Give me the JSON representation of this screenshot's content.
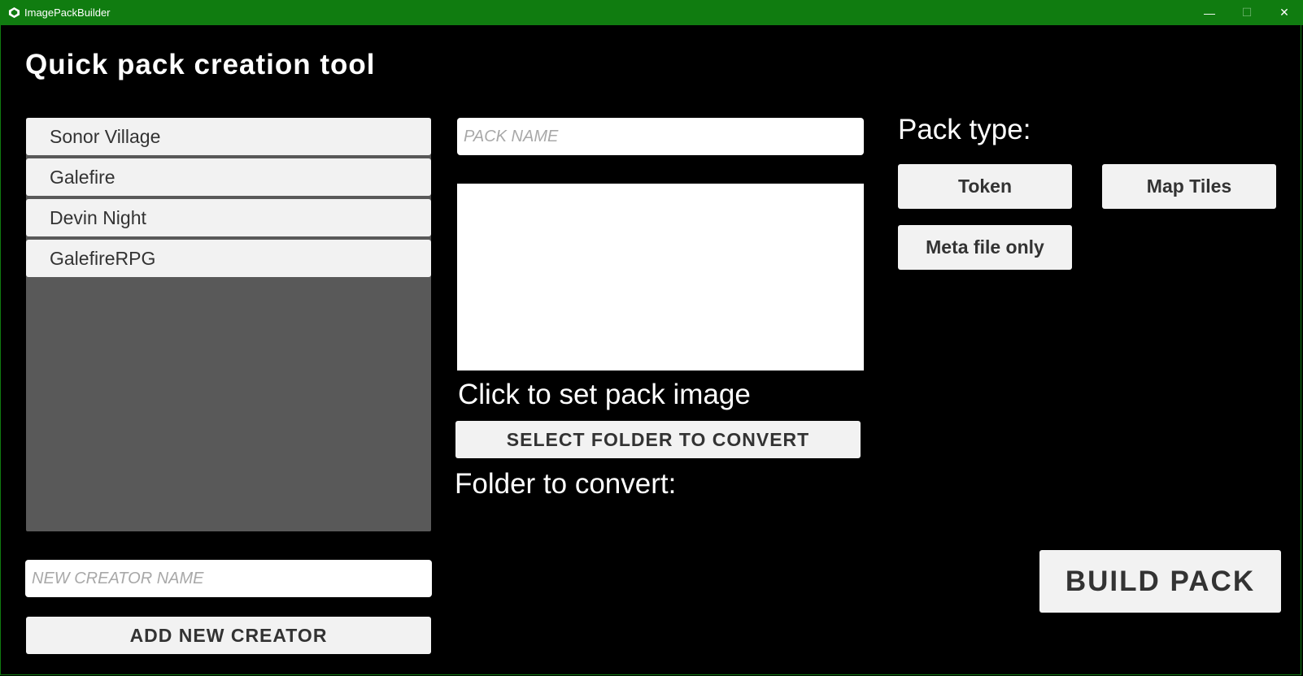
{
  "window": {
    "title": "ImagePackBuilder",
    "minimize_glyph": "—",
    "maximize_glyph": "☐",
    "close_glyph": "✕"
  },
  "heading": "Quick pack creation tool",
  "creators": [
    {
      "label": "Sonor Village"
    },
    {
      "label": "Galefire"
    },
    {
      "label": "Devin Night"
    },
    {
      "label": "GalefireRPG"
    }
  ],
  "new_creator": {
    "placeholder": "NEW CREATOR NAME",
    "value": ""
  },
  "add_creator_label": "ADD NEW CREATOR",
  "pack_name": {
    "placeholder": "PACK NAME",
    "value": ""
  },
  "pack_image_label": "Click to set pack image",
  "select_folder_label": "SELECT FOLDER TO CONVERT",
  "folder_to_convert_label": "Folder to convert:",
  "pack_type": {
    "label": "Pack type:",
    "options": [
      {
        "label": "Token"
      },
      {
        "label": "Map Tiles"
      },
      {
        "label": "Meta file only"
      }
    ]
  },
  "build_pack_label": "BUILD PACK",
  "colors": {
    "titlebar": "#107c10",
    "background": "#000000",
    "button": "#f2f2f2",
    "list_background": "#595959"
  }
}
